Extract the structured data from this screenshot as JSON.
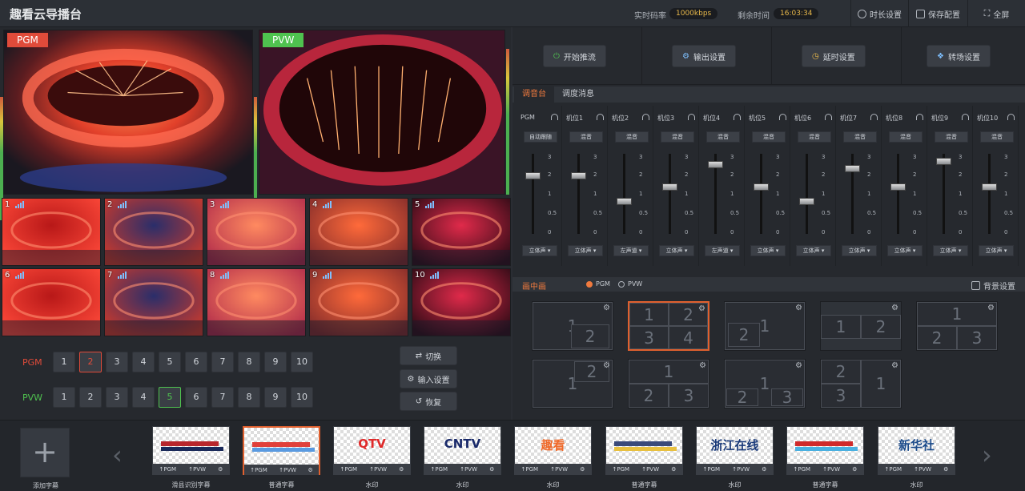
{
  "app": {
    "title": "趣看云导播台"
  },
  "topbar": {
    "bitrate_label": "实时码率",
    "bitrate_value": "1000kbps",
    "remaining_label": "剩余时间",
    "remaining_value": "16:03:34",
    "btn_duration": "时长设置",
    "btn_save": "保存配置",
    "btn_fullscreen": "全屏"
  },
  "monitors": {
    "pgm_tag": "PGM",
    "pvw_tag": "PVW"
  },
  "thumbs": [
    "1",
    "2",
    "3",
    "4",
    "5",
    "6",
    "7",
    "8",
    "9",
    "10"
  ],
  "switcher": {
    "pgm_label": "PGM",
    "pvw_label": "PVW",
    "sources": [
      "1",
      "2",
      "3",
      "4",
      "5",
      "6",
      "7",
      "8",
      "9",
      "10"
    ],
    "pgm_selected": "2",
    "pvw_selected": "5",
    "btn_switch": "切换",
    "btn_input": "输入设置",
    "btn_restore": "恢复"
  },
  "actions": {
    "start": "开始推流",
    "output": "输出设置",
    "delay": "延时设置",
    "transition": "转场设置"
  },
  "tabs": {
    "mixer": "调音台",
    "messages": "调度消息"
  },
  "mixer": {
    "scale": [
      "3",
      "2",
      "1",
      "0.5",
      "0"
    ],
    "channels": [
      {
        "name": "PGM",
        "btn": "自动跟随",
        "mode": "立体声",
        "level": 0.75
      },
      {
        "name": "机位1",
        "btn": "混音",
        "mode": "立体声",
        "level": 0.75
      },
      {
        "name": "机位2",
        "btn": "混音",
        "mode": "左声道",
        "level": 0.4
      },
      {
        "name": "机位3",
        "btn": "混音",
        "mode": "立体声",
        "level": 0.6
      },
      {
        "name": "机位4",
        "btn": "混音",
        "mode": "左声道",
        "level": 0.9
      },
      {
        "name": "机位5",
        "btn": "混音",
        "mode": "立体声",
        "level": 0.6
      },
      {
        "name": "机位6",
        "btn": "混音",
        "mode": "立体声",
        "level": 0.4
      },
      {
        "name": "机位7",
        "btn": "混音",
        "mode": "立体声",
        "level": 0.85
      },
      {
        "name": "机位8",
        "btn": "混音",
        "mode": "立体声",
        "level": 0.6
      },
      {
        "name": "机位9",
        "btn": "混音",
        "mode": "立体声",
        "level": 0.95
      },
      {
        "name": "机位10",
        "btn": "混音",
        "mode": "立体声",
        "level": 0.6
      }
    ]
  },
  "pip": {
    "title": "画中画",
    "opt_pgm": "PGM",
    "opt_pvw": "PVW",
    "bg_settings": "背景设置"
  },
  "captions": {
    "add_label": "添加字幕",
    "items": [
      {
        "label": "滑县识别字幕",
        "pgm": "PGM",
        "pvw": "PVW",
        "art": "bar-red"
      },
      {
        "label": "普通字幕",
        "pgm": "PGM",
        "pvw": "PVW",
        "art": "bar-blue"
      },
      {
        "label": "水印",
        "pgm": "PGM",
        "pvw": "PVW",
        "art": "QTV"
      },
      {
        "label": "水印",
        "pgm": "PGM",
        "pvw": "PVW",
        "art": "CNTV"
      },
      {
        "label": "水印",
        "pgm": "PGM",
        "pvw": "PVW",
        "art": "趣看"
      },
      {
        "label": "普通字幕",
        "pgm": "PGM",
        "pvw": "PVW",
        "art": "bar-navy"
      },
      {
        "label": "水印",
        "pgm": "PGM",
        "pvw": "PVW",
        "art": "浙江在线"
      },
      {
        "label": "普通字幕",
        "pgm": "PGM",
        "pvw": "PVW",
        "art": "bar-red2"
      },
      {
        "label": "水印",
        "pgm": "PGM",
        "pvw": "PVW",
        "art": "新华社"
      }
    ]
  },
  "colors": {
    "pgm": "#e04b3a",
    "pvw": "#4fc24f",
    "accent": "#f07a3e"
  }
}
